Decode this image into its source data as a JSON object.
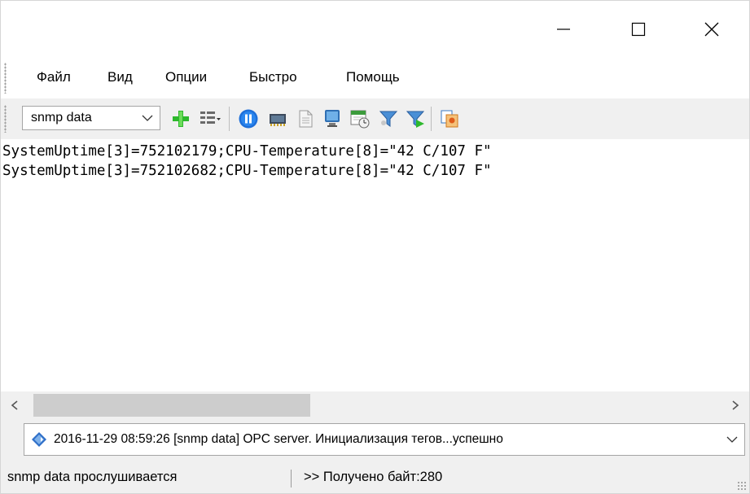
{
  "titlebar": {
    "minimize_icon": "minimize-icon",
    "maximize_icon": "maximize-icon",
    "close_icon": "close-icon"
  },
  "menu": {
    "items": [
      "Файл",
      "Вид",
      "Опции",
      "Быстро",
      "Помощь"
    ]
  },
  "toolbar": {
    "source_select": {
      "value": "snmp data"
    },
    "icons": [
      "add-icon",
      "list-columns-icon",
      "pause-icon",
      "memory-chip-icon",
      "document-icon",
      "monitor-icon",
      "calendar-clock-icon",
      "filter-icon",
      "filter-apply-icon",
      "copy-icon"
    ]
  },
  "content": {
    "lines": [
      "SystemUptime[3]=752102179;CPU-Temperature[8]=\"42 C/107 F\"",
      "SystemUptime[3]=752102682;CPU-Temperature[8]=\"42 C/107 F\""
    ]
  },
  "log": {
    "message": "2016-11-29 08:59:26 [snmp data] OPC server. Инициализация тегов...успешно"
  },
  "status": {
    "left": "snmp data прослушивается",
    "right": ">> Получено байт:280"
  },
  "colors": {
    "window_bg": "#f0f0f0",
    "accent_green": "#2db82d",
    "accent_blue": "#1e6fd9"
  }
}
